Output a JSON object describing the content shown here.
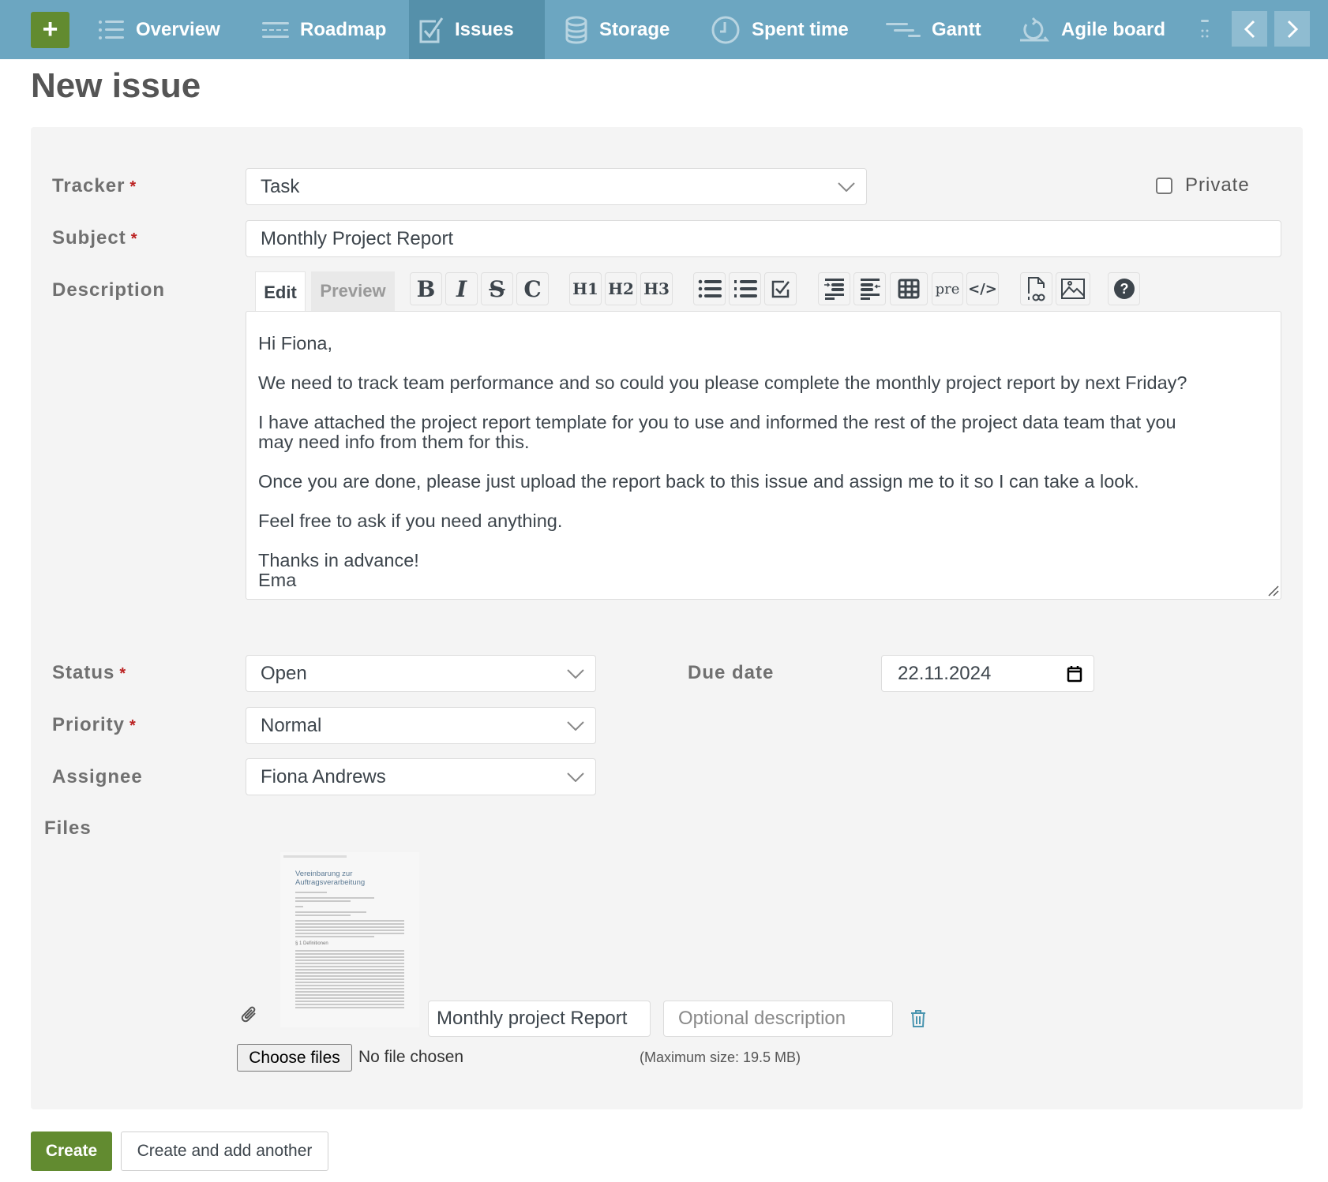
{
  "nav": {
    "add_label": "+",
    "items": [
      {
        "label": "Overview",
        "icon": "list-icon",
        "active": false
      },
      {
        "label": "Roadmap",
        "icon": "roadmap-icon",
        "active": false
      },
      {
        "label": "Issues",
        "icon": "checkbox-icon",
        "active": true
      },
      {
        "label": "Storage",
        "icon": "database-icon",
        "active": false
      },
      {
        "label": "Spent time",
        "icon": "clock-icon",
        "active": false
      },
      {
        "label": "Gantt",
        "icon": "gantt-icon",
        "active": false
      },
      {
        "label": "Agile board",
        "icon": "agile-icon",
        "active": false
      }
    ],
    "more_icon": "more-icon",
    "prev_icon": "chevron-left-icon",
    "next_icon": "chevron-right-icon"
  },
  "page": {
    "title": "New issue"
  },
  "form": {
    "tracker": {
      "label": "Tracker",
      "required": "*",
      "value": "Task"
    },
    "private": {
      "label": "Private",
      "checked": false
    },
    "subject": {
      "label": "Subject",
      "required": "*",
      "value": "Monthly Project Report"
    },
    "description": {
      "label": "Description",
      "tabs": {
        "edit": "Edit",
        "preview": "Preview"
      },
      "toolbar": [
        {
          "name": "bold",
          "text": "B"
        },
        {
          "name": "italic",
          "text": "I"
        },
        {
          "name": "strikethrough",
          "text": "S"
        },
        {
          "name": "inline-code",
          "text": "C"
        },
        {
          "name": "heading-1",
          "text": "H1"
        },
        {
          "name": "heading-2",
          "text": "H2"
        },
        {
          "name": "heading-3",
          "text": "H3"
        },
        {
          "name": "unordered-list",
          "text": ""
        },
        {
          "name": "ordered-list",
          "text": ""
        },
        {
          "name": "task-list",
          "text": ""
        },
        {
          "name": "quote",
          "text": ""
        },
        {
          "name": "unquote",
          "text": ""
        },
        {
          "name": "table",
          "text": ""
        },
        {
          "name": "preformatted",
          "text": "pre"
        },
        {
          "name": "code-highlight",
          "text": "</>"
        },
        {
          "name": "wiki-link",
          "text": ""
        },
        {
          "name": "image",
          "text": ""
        },
        {
          "name": "help",
          "text": "?"
        }
      ],
      "value": "Hi Fiona,\n\nWe need to track team performance and so could you please complete the monthly project report by next Friday?\n\nI have attached the project report template for you to use and informed the rest of the project data team that you\nmay need info from them for this.\n\nOnce you are done, please just upload the report back to this issue and assign me to it so I can take a look.\n\nFeel free to ask if you need anything.\n\nThanks in advance!\nEma"
    },
    "status": {
      "label": "Status",
      "required": "*",
      "value": "Open"
    },
    "priority": {
      "label": "Priority",
      "required": "*",
      "value": "Normal"
    },
    "assignee": {
      "label": "Assignee",
      "value": "Fiona Andrews"
    },
    "due_date": {
      "label": "Due date",
      "value": "22.11.2024"
    },
    "files": {
      "label": "Files",
      "attachment": {
        "thumbnail_title": "Vereinbarung zur Auftragsverarbeitung",
        "thumbnail_section": "§ 1 Definitionen",
        "filename": "Monthly project Report",
        "description_placeholder": "Optional description"
      },
      "choose_label": "Choose files",
      "no_file": "No file chosen",
      "max_size": "(Maximum size: 19.5 MB)"
    }
  },
  "actions": {
    "create": "Create",
    "create_another": "Create and add another"
  },
  "colors": {
    "nav": "#6ca6c1",
    "nav_active": "#5590aa",
    "primary": "#628b30",
    "required": "#bb2222"
  }
}
